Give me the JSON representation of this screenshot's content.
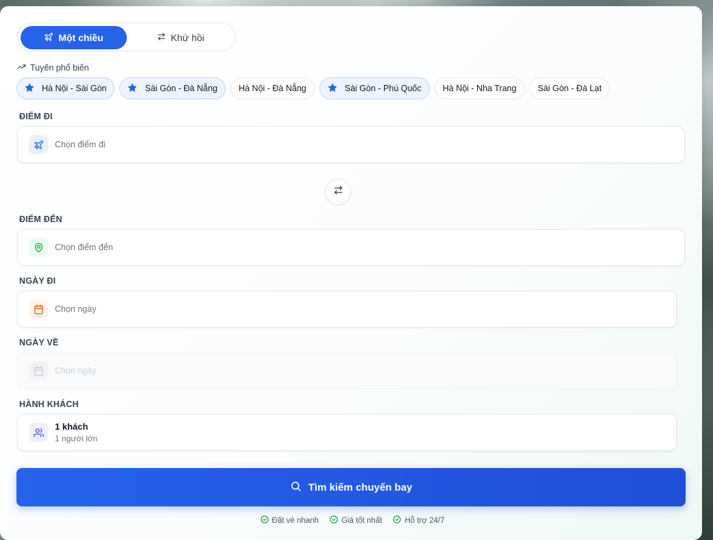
{
  "trip_type": {
    "one_way": "Một chiều",
    "round_trip": "Khứ hồi",
    "selected": "one_way"
  },
  "popular_routes": {
    "label": "Tuyến phổ biến",
    "items": [
      {
        "label": "Hà Nội - Sài Gòn",
        "favorite": true
      },
      {
        "label": "Sài Gòn - Đà Nẵng",
        "favorite": true
      },
      {
        "label": "Hà Nội - Đà Nẵng",
        "favorite": false
      },
      {
        "label": "Sài Gòn - Phú Quốc",
        "favorite": true
      },
      {
        "label": "Hà Nội - Nha Trang",
        "favorite": false
      },
      {
        "label": "Sài Gòn - Đà Lạt",
        "favorite": false
      }
    ]
  },
  "origin": {
    "label": "ĐIỂM ĐI",
    "placeholder": "Chọn điểm đi"
  },
  "destination": {
    "label": "ĐIỂM ĐẾN",
    "placeholder": "Chọn điểm đến"
  },
  "depart_date": {
    "label": "NGÀY ĐI",
    "placeholder": "Chọn ngày"
  },
  "return_date": {
    "label": "NGÀY VỀ",
    "placeholder": "Chọn ngày",
    "disabled": true
  },
  "passengers": {
    "label": "HÀNH KHÁCH",
    "summary": "1 khách",
    "detail": "1 người lớn"
  },
  "search_button": "Tìm kiếm chuyến bay",
  "features": [
    "Đặt vé nhanh",
    "Giá tốt nhất",
    "Hỗ trợ 24/7"
  ],
  "colors": {
    "primary": "#2563eb",
    "origin_icon": "#2563eb",
    "destination_icon": "#16a34a",
    "date_icon": "#ea580c",
    "passenger_icon": "#4f46e5",
    "feature_check": "#16a34a",
    "favorite_star": "#2563eb"
  }
}
